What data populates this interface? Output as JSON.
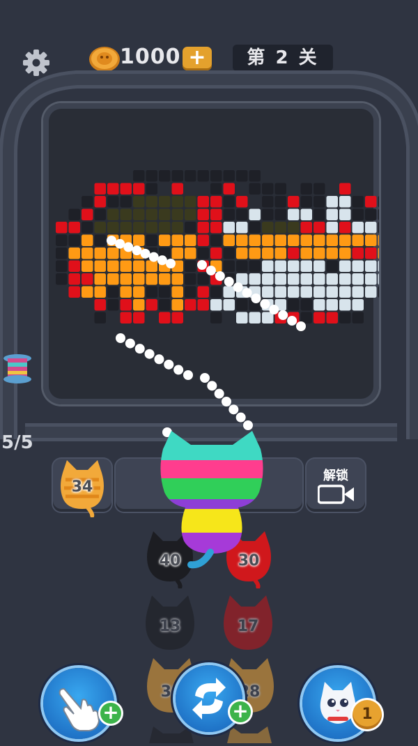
{
  "top_bar": {
    "coins": "1000",
    "coin_plus": "+",
    "level": "第 2 关"
  },
  "conveyor": {
    "counter": "5/5"
  },
  "slots": {
    "slot1_cat_count": "34",
    "slot3_label": "解锁"
  },
  "queue_cats": [
    {
      "count": "40",
      "color": "black"
    },
    {
      "count": "30",
      "color": "red"
    },
    {
      "count": "13",
      "color": "black"
    },
    {
      "count": "17",
      "color": "red"
    },
    {
      "count": "30",
      "color": "orange"
    },
    {
      "count": "28",
      "color": "orange"
    }
  ],
  "bottom_buttons": {
    "hand_plus": "+",
    "refresh_plus": "+",
    "cat_badge": "1"
  },
  "colors": {
    "background": "#2f3441",
    "board": "#292d36",
    "coin": "#e4a12d",
    "accent_green": "#3cb34a",
    "pixel_red": "#e0101a",
    "pixel_orange": "#ff9a14",
    "pixel_white": "#d8e4ec",
    "pixel_dark": "#252830"
  },
  "icons": {
    "settings": "gear-icon",
    "coin": "coin-icon",
    "video": "video-icon",
    "hand": "hand-pointer-icon",
    "refresh": "refresh-icon",
    "cat_helper": "cat-icon"
  }
}
